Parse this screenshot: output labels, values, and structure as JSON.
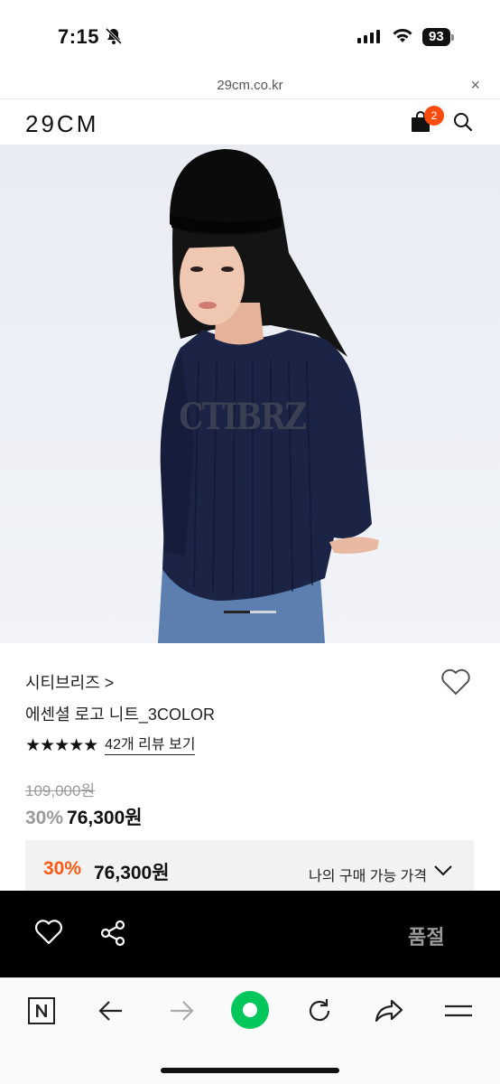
{
  "status_bar": {
    "time": "7:15",
    "battery": "93"
  },
  "url_bar": {
    "url": "29cm.co.kr",
    "close_label": "×"
  },
  "header": {
    "logo": "29CM",
    "cart_count": "2"
  },
  "hero": {
    "print_text": "CTIBRZ"
  },
  "product": {
    "brand": "시티브리즈 >",
    "name": "에센셜 로고 니트_3COLOR",
    "stars": "★★★★★",
    "review_link": "42개 리뷰 보기",
    "original_price": "109,000원",
    "discount": "30%",
    "sale_price": "76,300원"
  },
  "my_price": {
    "discount": "30%",
    "price": "76,300원",
    "label": "나의 구매 가능 가격"
  },
  "action_bar": {
    "soldout_label": "품절"
  },
  "colors": {
    "accent": "#ff5a14",
    "badge": "#ff4b0b",
    "action_bg": "#000000",
    "naver_green": "#03c75a"
  }
}
